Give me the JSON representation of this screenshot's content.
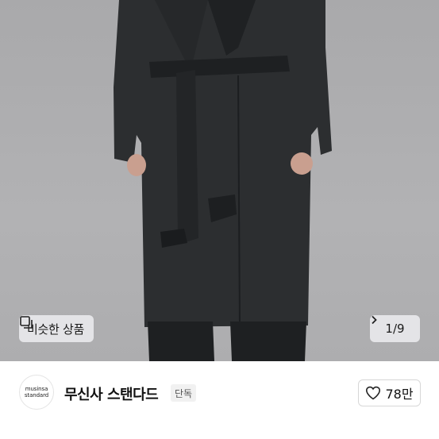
{
  "product_image": {
    "similar_products_label": "비슷한 상품",
    "pager_text": "1/9"
  },
  "brand": {
    "logo_line1": "musinsa",
    "logo_line2": "standard",
    "name": "무신사 스탠다드",
    "badge": "단독"
  },
  "like": {
    "count": "78만"
  },
  "icons": {
    "similar": "similar-products-icon",
    "pager_next": "chevron-right-icon",
    "like": "heart-outline-icon"
  },
  "colors": {
    "coat": "#2a2c2e",
    "background": "#b0b0b2"
  }
}
